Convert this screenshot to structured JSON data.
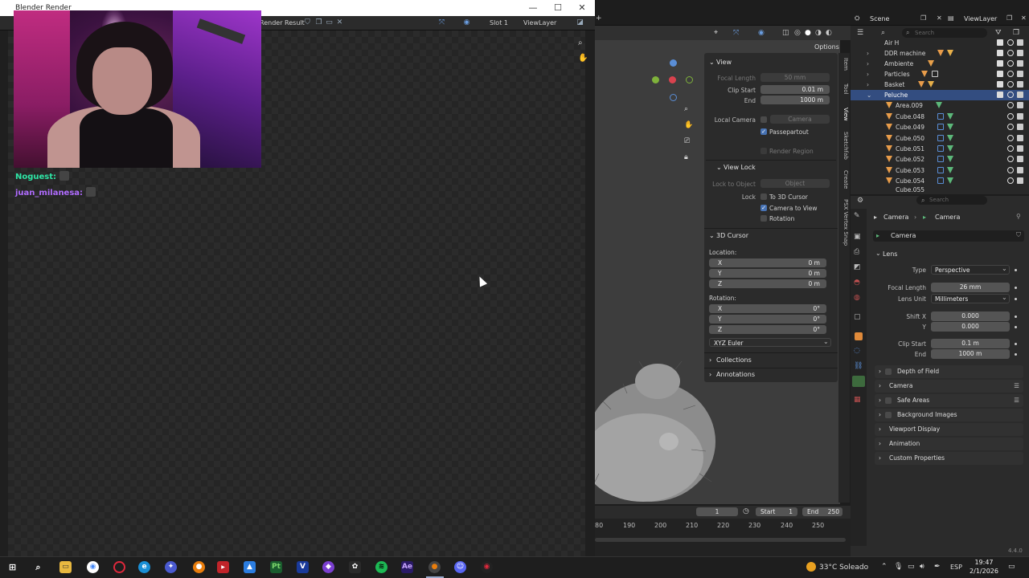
{
  "render_window": {
    "title": "Blender Render",
    "header": {
      "image_name": "Render Result",
      "slot": "Slot 1",
      "view_layer": "ViewLayer"
    },
    "controls": {
      "minimize": "—",
      "maximize": "☐",
      "close": "✕"
    }
  },
  "chat": [
    {
      "user": "Noguest:",
      "color": "#2ee6a6"
    },
    {
      "user": "juan_milanesa:",
      "color": "#b06cff"
    }
  ],
  "top_bar": {
    "scene": "Scene",
    "view_layer": "ViewLayer"
  },
  "viewport": {
    "options": "Options"
  },
  "npanel": {
    "tabs": [
      "Item",
      "Tool",
      "View",
      "Sketchfab",
      "Create",
      "PSX Vertex Snap"
    ],
    "view": {
      "title": "View",
      "focal_length_label": "Focal Length",
      "focal_length": "50 mm",
      "clip_start_label": "Clip Start",
      "clip_start": "0.01 m",
      "end_label": "End",
      "end": "1000 m",
      "local_camera_label": "Local Camera",
      "local_camera": "Camera",
      "passepartout": "Passepartout",
      "render_region": "Render Region"
    },
    "view_lock": {
      "title": "View Lock",
      "lock_to_object_label": "Lock to Object",
      "lock_to_object": "Object",
      "lock_label": "Lock",
      "to_3d_cursor": "To 3D Cursor",
      "camera_to_view": "Camera to View",
      "rotation": "Rotation"
    },
    "cursor": {
      "title": "3D Cursor",
      "location_label": "Location:",
      "loc_x_label": "X",
      "loc_x": "0 m",
      "loc_y_label": "Y",
      "loc_y": "0 m",
      "loc_z_label": "Z",
      "loc_z": "0 m",
      "rotation_label": "Rotation:",
      "rot_x_label": "X",
      "rot_x": "0°",
      "rot_y_label": "Y",
      "rot_y": "0°",
      "rot_z_label": "Z",
      "rot_z": "0°",
      "mode": "XYZ Euler"
    },
    "collections": "Collections",
    "annotations": "Annotations"
  },
  "timeline": {
    "current_frame": "1",
    "start_label": "Start",
    "start": "1",
    "end_label": "End",
    "end": "250",
    "ticks": [
      "80",
      "190",
      "200",
      "210",
      "220",
      "230",
      "240",
      "250"
    ]
  },
  "outliner": {
    "search_placeholder": "Search",
    "rows": [
      {
        "name": "Air H"
      },
      {
        "name": "DDR machine"
      },
      {
        "name": "Ambiente"
      },
      {
        "name": "Particles"
      },
      {
        "name": "Basket"
      },
      {
        "name": "Peluche"
      },
      {
        "name": "Area.009"
      },
      {
        "name": "Cube.048"
      },
      {
        "name": "Cube.049"
      },
      {
        "name": "Cube.050"
      },
      {
        "name": "Cube.051"
      },
      {
        "name": "Cube.052"
      },
      {
        "name": "Cube.053"
      },
      {
        "name": "Cube.054"
      },
      {
        "name": "Cube.055"
      }
    ]
  },
  "properties": {
    "search_placeholder": "Search",
    "breadcrumb_object": "Camera",
    "breadcrumb_data": "Camera",
    "datablock": "Camera",
    "lens": {
      "title": "Lens",
      "type_label": "Type",
      "type": "Perspective",
      "focal_length_label": "Focal Length",
      "focal_length": "26 mm",
      "lens_unit_label": "Lens Unit",
      "lens_unit": "Millimeters",
      "shift_x_label": "Shift X",
      "shift_x": "0.000",
      "shift_y_label": "Y",
      "shift_y": "0.000",
      "clip_start_label": "Clip Start",
      "clip_start": "0.1 m",
      "clip_end_label": "End",
      "clip_end": "1000 m"
    },
    "sections": [
      "Depth of Field",
      "Camera",
      "Safe Areas",
      "Background Images",
      "Viewport Display",
      "Animation",
      "Custom Properties"
    ],
    "version": "4.4.0"
  },
  "taskbar": {
    "weather": "33°C  Soleado",
    "lang": "ESP",
    "time": "19:47",
    "date": "2/1/2026"
  },
  "colors": {
    "accent_blue": "#4772b3",
    "selected_row": "#334d80",
    "panel_bg": "#2b2b2b"
  }
}
